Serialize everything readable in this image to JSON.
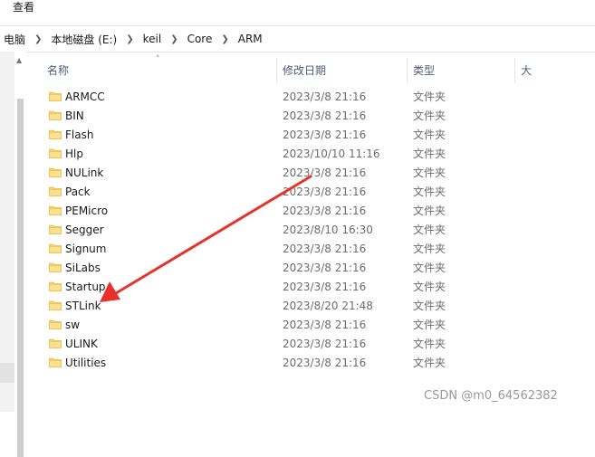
{
  "menubar": {
    "view_label": "查看"
  },
  "breadcrumb": [
    "电脑",
    "本地磁盘 (E:)",
    "keil",
    "Core",
    "ARM"
  ],
  "columns": {
    "name": "名称",
    "modified": "修改日期",
    "type": "类型",
    "size": "大"
  },
  "files": [
    {
      "name": "ARMCC",
      "modified": "2023/3/8 21:16",
      "type": "文件夹"
    },
    {
      "name": "BIN",
      "modified": "2023/3/8 21:16",
      "type": "文件夹"
    },
    {
      "name": "Flash",
      "modified": "2023/3/8 21:16",
      "type": "文件夹"
    },
    {
      "name": "Hlp",
      "modified": "2023/10/10 11:16",
      "type": "文件夹"
    },
    {
      "name": "NULink",
      "modified": "2023/3/8 21:16",
      "type": "文件夹"
    },
    {
      "name": "Pack",
      "modified": "2023/3/8 21:16",
      "type": "文件夹"
    },
    {
      "name": "PEMicro",
      "modified": "2023/3/8 21:16",
      "type": "文件夹"
    },
    {
      "name": "Segger",
      "modified": "2023/8/10 16:30",
      "type": "文件夹"
    },
    {
      "name": "Signum",
      "modified": "2023/3/8 21:16",
      "type": "文件夹"
    },
    {
      "name": "SiLabs",
      "modified": "2023/3/8 21:16",
      "type": "文件夹"
    },
    {
      "name": "Startup",
      "modified": "2023/3/8 21:16",
      "type": "文件夹"
    },
    {
      "name": "STLink",
      "modified": "2023/8/20 21:48",
      "type": "文件夹"
    },
    {
      "name": "sw",
      "modified": "2023/3/8 21:16",
      "type": "文件夹"
    },
    {
      "name": "ULINK",
      "modified": "2023/3/8 21:16",
      "type": "文件夹"
    },
    {
      "name": "Utilities",
      "modified": "2023/3/8 21:16",
      "type": "文件夹"
    }
  ],
  "watermark": "CSDN @m0_64562382",
  "colors": {
    "arrow": "#e8312a",
    "folder": "#f8d775",
    "folder_dark": "#e6b94a",
    "header_text": "#4c607a"
  },
  "icons": {
    "folder": "folder-icon",
    "breadcrumb_separator": "chevron-right-icon",
    "sort": "chevron-up-icon",
    "scroll_up": "scroll-up-arrow-icon"
  }
}
